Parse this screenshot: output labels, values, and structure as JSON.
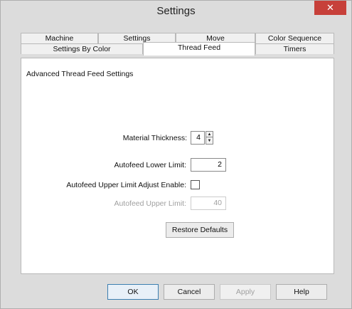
{
  "window": {
    "title": "Settings",
    "close_glyph": "✕",
    "accent": "#c7403a"
  },
  "tabs": {
    "row1": [
      "Machine",
      "Settings",
      "Move",
      "Color Sequence"
    ],
    "row2": [
      "Settings By Color",
      "Thread Feed",
      "Timers"
    ],
    "active": "Thread Feed"
  },
  "panel": {
    "heading": "Advanced Thread Feed Settings",
    "material_thickness": {
      "label": "Material Thickness:",
      "value": "4"
    },
    "autofeed_lower": {
      "label": "Autofeed Lower Limit:",
      "value": "2"
    },
    "upper_enable": {
      "label": "Autofeed Upper Limit Adjust Enable:",
      "checked": false
    },
    "autofeed_upper": {
      "label": "Autofeed Upper Limit:",
      "value": "40"
    },
    "restore_label": "Restore Defaults"
  },
  "footer": {
    "ok": "OK",
    "cancel": "Cancel",
    "apply": "Apply",
    "help": "Help"
  },
  "icons": {
    "spin_up": "▲",
    "spin_down": "▼"
  }
}
